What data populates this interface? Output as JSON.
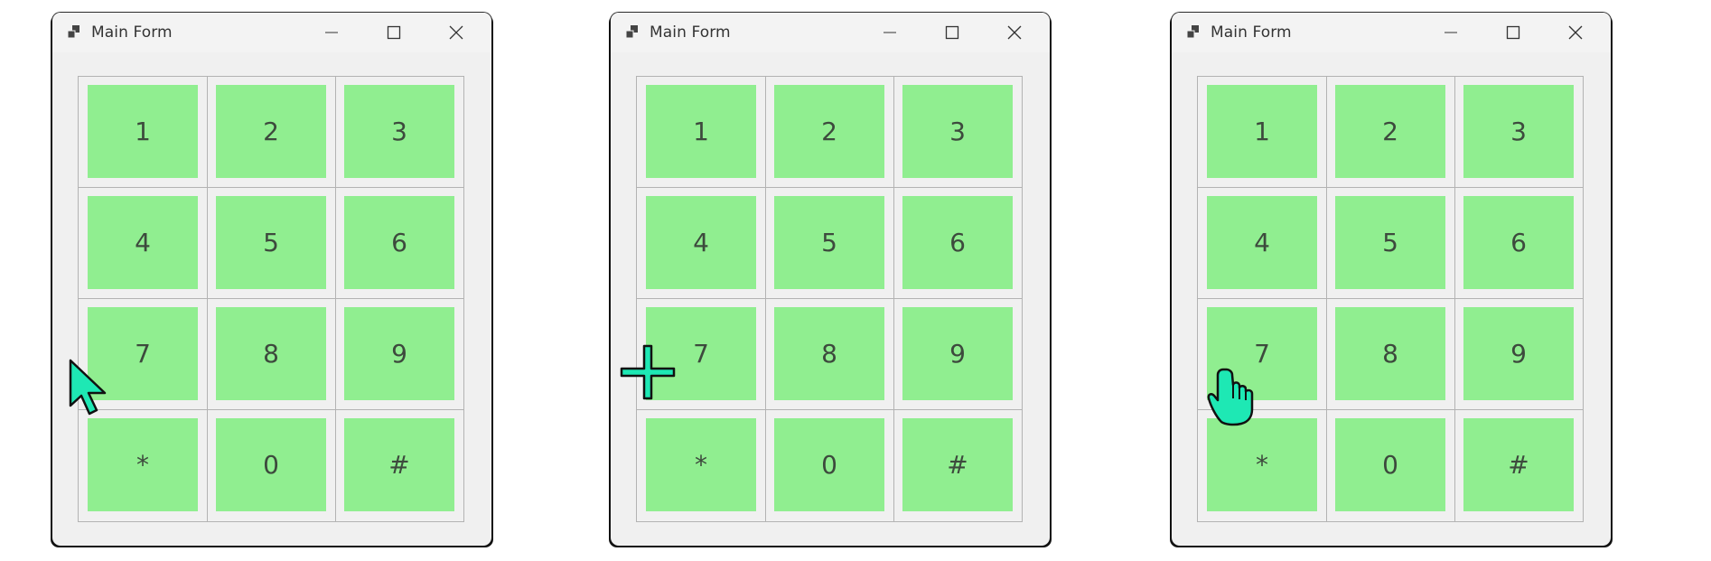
{
  "windows": [
    {
      "title": "Main Form",
      "cursor": "arrow-cursor-icon",
      "keys": [
        "1",
        "2",
        "3",
        "4",
        "5",
        "6",
        "7",
        "8",
        "9",
        "*",
        "0",
        "#"
      ]
    },
    {
      "title": "Main Form",
      "cursor": "crosshair-cursor-icon",
      "keys": [
        "1",
        "2",
        "3",
        "4",
        "5",
        "6",
        "7",
        "8",
        "9",
        "*",
        "0",
        "#"
      ]
    },
    {
      "title": "Main Form",
      "cursor": "hand-pointer-cursor-icon",
      "keys": [
        "1",
        "2",
        "3",
        "4",
        "5",
        "6",
        "7",
        "8",
        "9",
        "*",
        "0",
        "#"
      ]
    }
  ],
  "colors": {
    "key_fill": "#90ee90",
    "key_text": "#3d4a3d",
    "cursor_fill": "#1ee8b4",
    "grid_line": "#b3b3b3",
    "window_bg": "#f0f0f0"
  }
}
